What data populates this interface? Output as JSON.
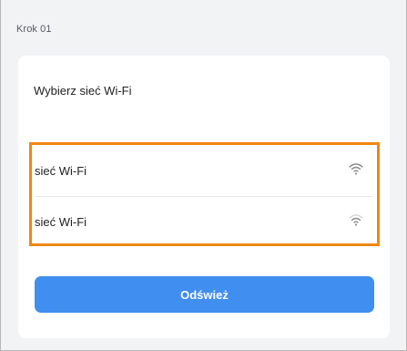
{
  "step": {
    "label": "Krok 01"
  },
  "card": {
    "title": "Wybierz sieć Wi-Fi"
  },
  "networks": [
    {
      "name": "sieć Wi-Fi",
      "icon": "wifi-strong-icon"
    },
    {
      "name": "sieć Wi-Fi",
      "icon": "wifi-weak-icon"
    }
  ],
  "actions": {
    "refresh_label": "Odśwież"
  },
  "colors": {
    "highlight_border": "#f08712",
    "button_background": "#3f8ef0",
    "page_background": "#f2f3f5",
    "card_background": "#ffffff"
  }
}
